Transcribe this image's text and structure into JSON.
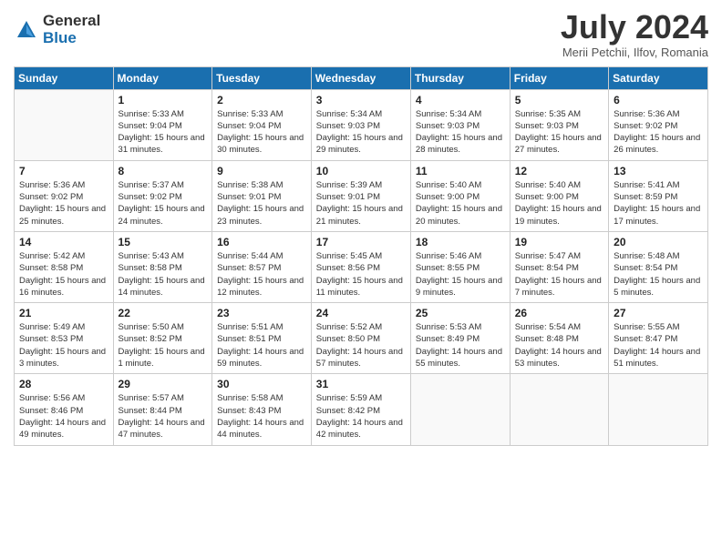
{
  "header": {
    "logo_general": "General",
    "logo_blue": "Blue",
    "month_title": "July 2024",
    "location": "Merii Petchii, Ilfov, Romania"
  },
  "days_of_week": [
    "Sunday",
    "Monday",
    "Tuesday",
    "Wednesday",
    "Thursday",
    "Friday",
    "Saturday"
  ],
  "weeks": [
    [
      {
        "num": "",
        "sunrise": "",
        "sunset": "",
        "daylight": "",
        "empty": true
      },
      {
        "num": "1",
        "sunrise": "Sunrise: 5:33 AM",
        "sunset": "Sunset: 9:04 PM",
        "daylight": "Daylight: 15 hours and 31 minutes.",
        "empty": false
      },
      {
        "num": "2",
        "sunrise": "Sunrise: 5:33 AM",
        "sunset": "Sunset: 9:04 PM",
        "daylight": "Daylight: 15 hours and 30 minutes.",
        "empty": false
      },
      {
        "num": "3",
        "sunrise": "Sunrise: 5:34 AM",
        "sunset": "Sunset: 9:03 PM",
        "daylight": "Daylight: 15 hours and 29 minutes.",
        "empty": false
      },
      {
        "num": "4",
        "sunrise": "Sunrise: 5:34 AM",
        "sunset": "Sunset: 9:03 PM",
        "daylight": "Daylight: 15 hours and 28 minutes.",
        "empty": false
      },
      {
        "num": "5",
        "sunrise": "Sunrise: 5:35 AM",
        "sunset": "Sunset: 9:03 PM",
        "daylight": "Daylight: 15 hours and 27 minutes.",
        "empty": false
      },
      {
        "num": "6",
        "sunrise": "Sunrise: 5:36 AM",
        "sunset": "Sunset: 9:02 PM",
        "daylight": "Daylight: 15 hours and 26 minutes.",
        "empty": false
      }
    ],
    [
      {
        "num": "7",
        "sunrise": "Sunrise: 5:36 AM",
        "sunset": "Sunset: 9:02 PM",
        "daylight": "Daylight: 15 hours and 25 minutes.",
        "empty": false
      },
      {
        "num": "8",
        "sunrise": "Sunrise: 5:37 AM",
        "sunset": "Sunset: 9:02 PM",
        "daylight": "Daylight: 15 hours and 24 minutes.",
        "empty": false
      },
      {
        "num": "9",
        "sunrise": "Sunrise: 5:38 AM",
        "sunset": "Sunset: 9:01 PM",
        "daylight": "Daylight: 15 hours and 23 minutes.",
        "empty": false
      },
      {
        "num": "10",
        "sunrise": "Sunrise: 5:39 AM",
        "sunset": "Sunset: 9:01 PM",
        "daylight": "Daylight: 15 hours and 21 minutes.",
        "empty": false
      },
      {
        "num": "11",
        "sunrise": "Sunrise: 5:40 AM",
        "sunset": "Sunset: 9:00 PM",
        "daylight": "Daylight: 15 hours and 20 minutes.",
        "empty": false
      },
      {
        "num": "12",
        "sunrise": "Sunrise: 5:40 AM",
        "sunset": "Sunset: 9:00 PM",
        "daylight": "Daylight: 15 hours and 19 minutes.",
        "empty": false
      },
      {
        "num": "13",
        "sunrise": "Sunrise: 5:41 AM",
        "sunset": "Sunset: 8:59 PM",
        "daylight": "Daylight: 15 hours and 17 minutes.",
        "empty": false
      }
    ],
    [
      {
        "num": "14",
        "sunrise": "Sunrise: 5:42 AM",
        "sunset": "Sunset: 8:58 PM",
        "daylight": "Daylight: 15 hours and 16 minutes.",
        "empty": false
      },
      {
        "num": "15",
        "sunrise": "Sunrise: 5:43 AM",
        "sunset": "Sunset: 8:58 PM",
        "daylight": "Daylight: 15 hours and 14 minutes.",
        "empty": false
      },
      {
        "num": "16",
        "sunrise": "Sunrise: 5:44 AM",
        "sunset": "Sunset: 8:57 PM",
        "daylight": "Daylight: 15 hours and 12 minutes.",
        "empty": false
      },
      {
        "num": "17",
        "sunrise": "Sunrise: 5:45 AM",
        "sunset": "Sunset: 8:56 PM",
        "daylight": "Daylight: 15 hours and 11 minutes.",
        "empty": false
      },
      {
        "num": "18",
        "sunrise": "Sunrise: 5:46 AM",
        "sunset": "Sunset: 8:55 PM",
        "daylight": "Daylight: 15 hours and 9 minutes.",
        "empty": false
      },
      {
        "num": "19",
        "sunrise": "Sunrise: 5:47 AM",
        "sunset": "Sunset: 8:54 PM",
        "daylight": "Daylight: 15 hours and 7 minutes.",
        "empty": false
      },
      {
        "num": "20",
        "sunrise": "Sunrise: 5:48 AM",
        "sunset": "Sunset: 8:54 PM",
        "daylight": "Daylight: 15 hours and 5 minutes.",
        "empty": false
      }
    ],
    [
      {
        "num": "21",
        "sunrise": "Sunrise: 5:49 AM",
        "sunset": "Sunset: 8:53 PM",
        "daylight": "Daylight: 15 hours and 3 minutes.",
        "empty": false
      },
      {
        "num": "22",
        "sunrise": "Sunrise: 5:50 AM",
        "sunset": "Sunset: 8:52 PM",
        "daylight": "Daylight: 15 hours and 1 minute.",
        "empty": false
      },
      {
        "num": "23",
        "sunrise": "Sunrise: 5:51 AM",
        "sunset": "Sunset: 8:51 PM",
        "daylight": "Daylight: 14 hours and 59 minutes.",
        "empty": false
      },
      {
        "num": "24",
        "sunrise": "Sunrise: 5:52 AM",
        "sunset": "Sunset: 8:50 PM",
        "daylight": "Daylight: 14 hours and 57 minutes.",
        "empty": false
      },
      {
        "num": "25",
        "sunrise": "Sunrise: 5:53 AM",
        "sunset": "Sunset: 8:49 PM",
        "daylight": "Daylight: 14 hours and 55 minutes.",
        "empty": false
      },
      {
        "num": "26",
        "sunrise": "Sunrise: 5:54 AM",
        "sunset": "Sunset: 8:48 PM",
        "daylight": "Daylight: 14 hours and 53 minutes.",
        "empty": false
      },
      {
        "num": "27",
        "sunrise": "Sunrise: 5:55 AM",
        "sunset": "Sunset: 8:47 PM",
        "daylight": "Daylight: 14 hours and 51 minutes.",
        "empty": false
      }
    ],
    [
      {
        "num": "28",
        "sunrise": "Sunrise: 5:56 AM",
        "sunset": "Sunset: 8:46 PM",
        "daylight": "Daylight: 14 hours and 49 minutes.",
        "empty": false
      },
      {
        "num": "29",
        "sunrise": "Sunrise: 5:57 AM",
        "sunset": "Sunset: 8:44 PM",
        "daylight": "Daylight: 14 hours and 47 minutes.",
        "empty": false
      },
      {
        "num": "30",
        "sunrise": "Sunrise: 5:58 AM",
        "sunset": "Sunset: 8:43 PM",
        "daylight": "Daylight: 14 hours and 44 minutes.",
        "empty": false
      },
      {
        "num": "31",
        "sunrise": "Sunrise: 5:59 AM",
        "sunset": "Sunset: 8:42 PM",
        "daylight": "Daylight: 14 hours and 42 minutes.",
        "empty": false
      },
      {
        "num": "",
        "sunrise": "",
        "sunset": "",
        "daylight": "",
        "empty": true
      },
      {
        "num": "",
        "sunrise": "",
        "sunset": "",
        "daylight": "",
        "empty": true
      },
      {
        "num": "",
        "sunrise": "",
        "sunset": "",
        "daylight": "",
        "empty": true
      }
    ]
  ]
}
